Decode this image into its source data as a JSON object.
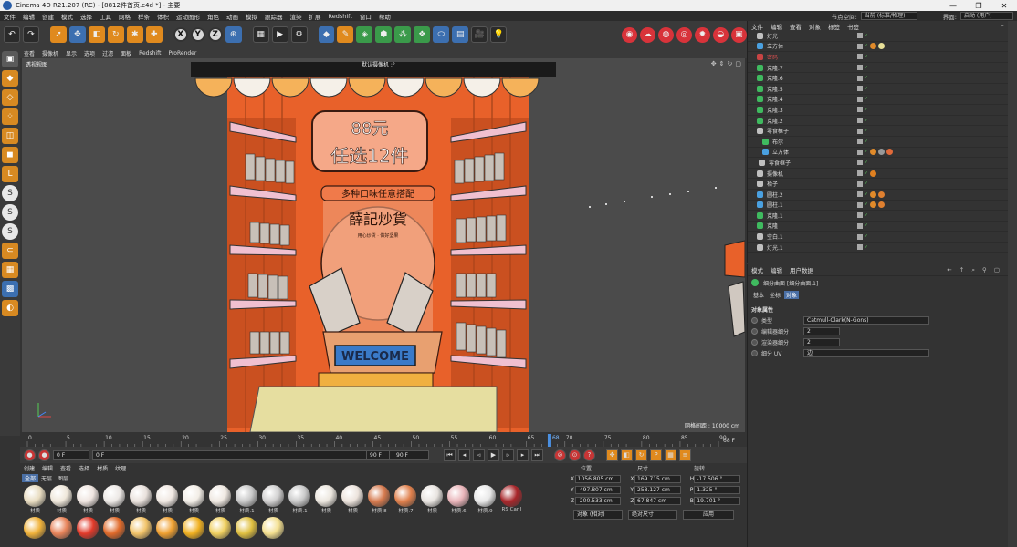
{
  "titlebar": {
    "title": "Cinema 4D R21.207 (RC) - [8812件首页.c4d *] - 主要",
    "min": "—",
    "max": "❐",
    "close": "✕"
  },
  "menubar": {
    "items": [
      "文件",
      "编辑",
      "创建",
      "模式",
      "选择",
      "工具",
      "网格",
      "样条",
      "体积",
      "运动图形",
      "角色",
      "动画",
      "模拟",
      "跟踪器",
      "渲染",
      "扩展",
      "Redshift",
      "窗口",
      "帮助"
    ],
    "node_space_label": "节点空间:",
    "node_space_value": "当前 (标准/物理)",
    "layout_label": "界面:",
    "layout_value": "启动 (用户)"
  },
  "toolbar": {
    "icons": [
      "undo-icon",
      "select-icon",
      "move-icon",
      "scale-icon",
      "rotate-icon",
      "recent-icon",
      "coord-icon",
      "x-axis",
      "y-axis",
      "z-axis",
      "world-icon",
      "render-view-icon",
      "render-icon",
      "render-settings-icon",
      "cube-icon",
      "pen-icon",
      "subdivision-icon",
      "extrude-icon",
      "deformer-icon",
      "mograph-icon",
      "field-icon",
      "camera-icon",
      "light-icon"
    ],
    "x": "X",
    "y": "Y",
    "z": "Z"
  },
  "viewport": {
    "menu": [
      "查看",
      "摄像机",
      "显示",
      "选项",
      "过滤",
      "面板",
      "Redshift",
      "ProRender"
    ],
    "view_name": "透视视图",
    "camera_name": "默认摄像机 :°",
    "grid_spacing": "网格间距 : 10000 cm",
    "sign_price": "88元",
    "sign_offer": "任选12件",
    "banner": "多种口味任意搭配",
    "logo_text": "薛記炒貨",
    "logo_sub": "用心炒货 · 做好坚果",
    "welcome": "WELCOME"
  },
  "timeline": {
    "ticks": [
      "0",
      "5",
      "10",
      "15",
      "20",
      "25",
      "30",
      "35",
      "40",
      "45",
      "50",
      "55",
      "60",
      "65",
      "70",
      "75",
      "80",
      "85",
      "90"
    ],
    "current_frame": "68",
    "current_field": "68 F",
    "current_marker": "68"
  },
  "playbar": {
    "start": "0 F",
    "start2": "0 F",
    "end": "90 F",
    "end2": "90 F"
  },
  "materials": {
    "menu": [
      "创建",
      "编辑",
      "查看",
      "选择",
      "材质",
      "纹理"
    ],
    "tabs": [
      "全部",
      "无层",
      "图层"
    ],
    "items": [
      {
        "label": "材质",
        "color": "#e8dcc0"
      },
      {
        "label": "材质",
        "color": "#efe7da"
      },
      {
        "label": "材质",
        "color": "#efe5e0"
      },
      {
        "label": "材质",
        "color": "#ece8e5"
      },
      {
        "label": "材质",
        "color": "#e9e1dc"
      },
      {
        "label": "材质",
        "color": "#f0e8e2"
      },
      {
        "label": "材质",
        "color": "#f2ede6"
      },
      {
        "label": "材质",
        "color": "#efe8e1"
      },
      {
        "label": "材质.1",
        "color": "#c8c8c8"
      },
      {
        "label": "材质",
        "color": "#d0cfcf"
      },
      {
        "label": "材质.1",
        "color": "#c9c9c9"
      },
      {
        "label": "材质",
        "color": "#ebe6de"
      },
      {
        "label": "材质",
        "color": "#ece3dc"
      },
      {
        "label": "材质.8",
        "color": "#d67a4e"
      },
      {
        "label": "材质.7",
        "color": "#e0804c"
      },
      {
        "label": "材质",
        "color": "#e8e4e0"
      },
      {
        "label": "材质.6",
        "color": "#e9b4b9"
      },
      {
        "label": "材质.9",
        "color": "#e8e8e8"
      },
      {
        "label": "RS Car I",
        "color": "#a8262a"
      }
    ],
    "row2": [
      "#f0b23a",
      "#e8845a",
      "#e23a2a",
      "#e06a2a",
      "#f2c46a",
      "#f0a030",
      "#f0b020",
      "#f0d060",
      "#e0c040",
      "#f4e090"
    ]
  },
  "coords": {
    "headers": [
      "位置",
      "尺寸",
      "旋转"
    ],
    "rows": [
      {
        "ax": "X",
        "pos": "1056.805 cm",
        "ax2": "X",
        "size": "169.715 cm",
        "ax3": "H",
        "rot": "-17.506 °"
      },
      {
        "ax": "Y",
        "pos": "-497.807 cm",
        "ax2": "Y",
        "size": "258.127 cm",
        "ax3": "P",
        "rot": "1.325 °"
      },
      {
        "ax": "Z",
        "pos": "-200.533 cm",
        "ax2": "Z",
        "size": "67.847 cm",
        "ax3": "B",
        "rot": "19.701 °"
      }
    ],
    "mode_left": "对象 (相对)",
    "mode_mid": "绝对尺寸",
    "apply": "应用"
  },
  "objects": {
    "menu": [
      "文件",
      "编辑",
      "查看",
      "对象",
      "标签",
      "书签"
    ],
    "rows": [
      {
        "name": "灯光",
        "color": "#c0c0c0",
        "name_color": "#dddddd",
        "tags": []
      },
      {
        "name": "立方体",
        "color": "#4aa0e0",
        "name_color": "#dddddd",
        "tags": [
          "#e08a2a",
          "#e8e098"
        ]
      },
      {
        "name": "密码",
        "color": "#c84444",
        "name_color": "#e05050",
        "tags": []
      },
      {
        "name": "克隆.7",
        "color": "#3fba5f",
        "name_color": "#dddddd",
        "tags": []
      },
      {
        "name": "克隆.6",
        "color": "#3fba5f",
        "name_color": "#dddddd",
        "tags": []
      },
      {
        "name": "克隆.5",
        "color": "#3fba5f",
        "name_color": "#dddddd",
        "tags": []
      },
      {
        "name": "克隆.4",
        "color": "#3fba5f",
        "name_color": "#dddddd",
        "tags": []
      },
      {
        "name": "克隆.3",
        "color": "#3fba5f",
        "name_color": "#dddddd",
        "tags": []
      },
      {
        "name": "克隆.2",
        "color": "#3fba5f",
        "name_color": "#dddddd",
        "tags": []
      },
      {
        "name": "零食框子",
        "color": "#c0c0c0",
        "name_color": "#dddddd",
        "tags": []
      },
      {
        "name": "布尔",
        "color": "#3fba5f",
        "name_color": "#dddddd",
        "tags": []
      },
      {
        "name": "立方体",
        "color": "#4aa0e0",
        "name_color": "#dddddd",
        "tags": [
          "#e08a2a",
          "#999999",
          "#e06a3a"
        ]
      },
      {
        "name": "零食框子",
        "color": "#c0c0c0",
        "name_color": "#dddddd",
        "tags": []
      },
      {
        "name": "摄像机",
        "color": "#c0c0c0",
        "name_color": "#dddddd",
        "tags": [
          "#e08020"
        ]
      },
      {
        "name": "枱子",
        "color": "#c0c0c0",
        "name_color": "#dddddd",
        "tags": []
      },
      {
        "name": "圆柱.2",
        "color": "#4aa0e0",
        "name_color": "#dddddd",
        "tags": [
          "#e08a2a",
          "#e08030"
        ]
      },
      {
        "name": "圆柱.1",
        "color": "#4aa0e0",
        "name_color": "#dddddd",
        "tags": [
          "#e08a2a",
          "#e08030"
        ]
      },
      {
        "name": "克隆.1",
        "color": "#3fba5f",
        "name_color": "#dddddd",
        "tags": []
      },
      {
        "name": "克隆",
        "color": "#3fba5f",
        "name_color": "#dddddd",
        "tags": []
      },
      {
        "name": "空白.1",
        "color": "#c0c0c0",
        "name_color": "#dddddd",
        "tags": []
      },
      {
        "name": "灯光.1",
        "color": "#c0c0c0",
        "name_color": "#dddddd",
        "tags": []
      }
    ]
  },
  "attributes": {
    "menu": [
      "模式",
      "编辑",
      "用户数据"
    ],
    "title": "细分曲面 [细分曲面.1]",
    "tabs": [
      "基本",
      "坐标",
      "对象"
    ],
    "section": "对象属性",
    "fields": [
      {
        "label": "类型",
        "value": "Catmull-Clark(N-Gons)"
      },
      {
        "label": "编辑器细分",
        "value": "2"
      },
      {
        "label": "渲染器细分",
        "value": "2"
      },
      {
        "label": "细分 UV",
        "value": "边"
      }
    ]
  }
}
